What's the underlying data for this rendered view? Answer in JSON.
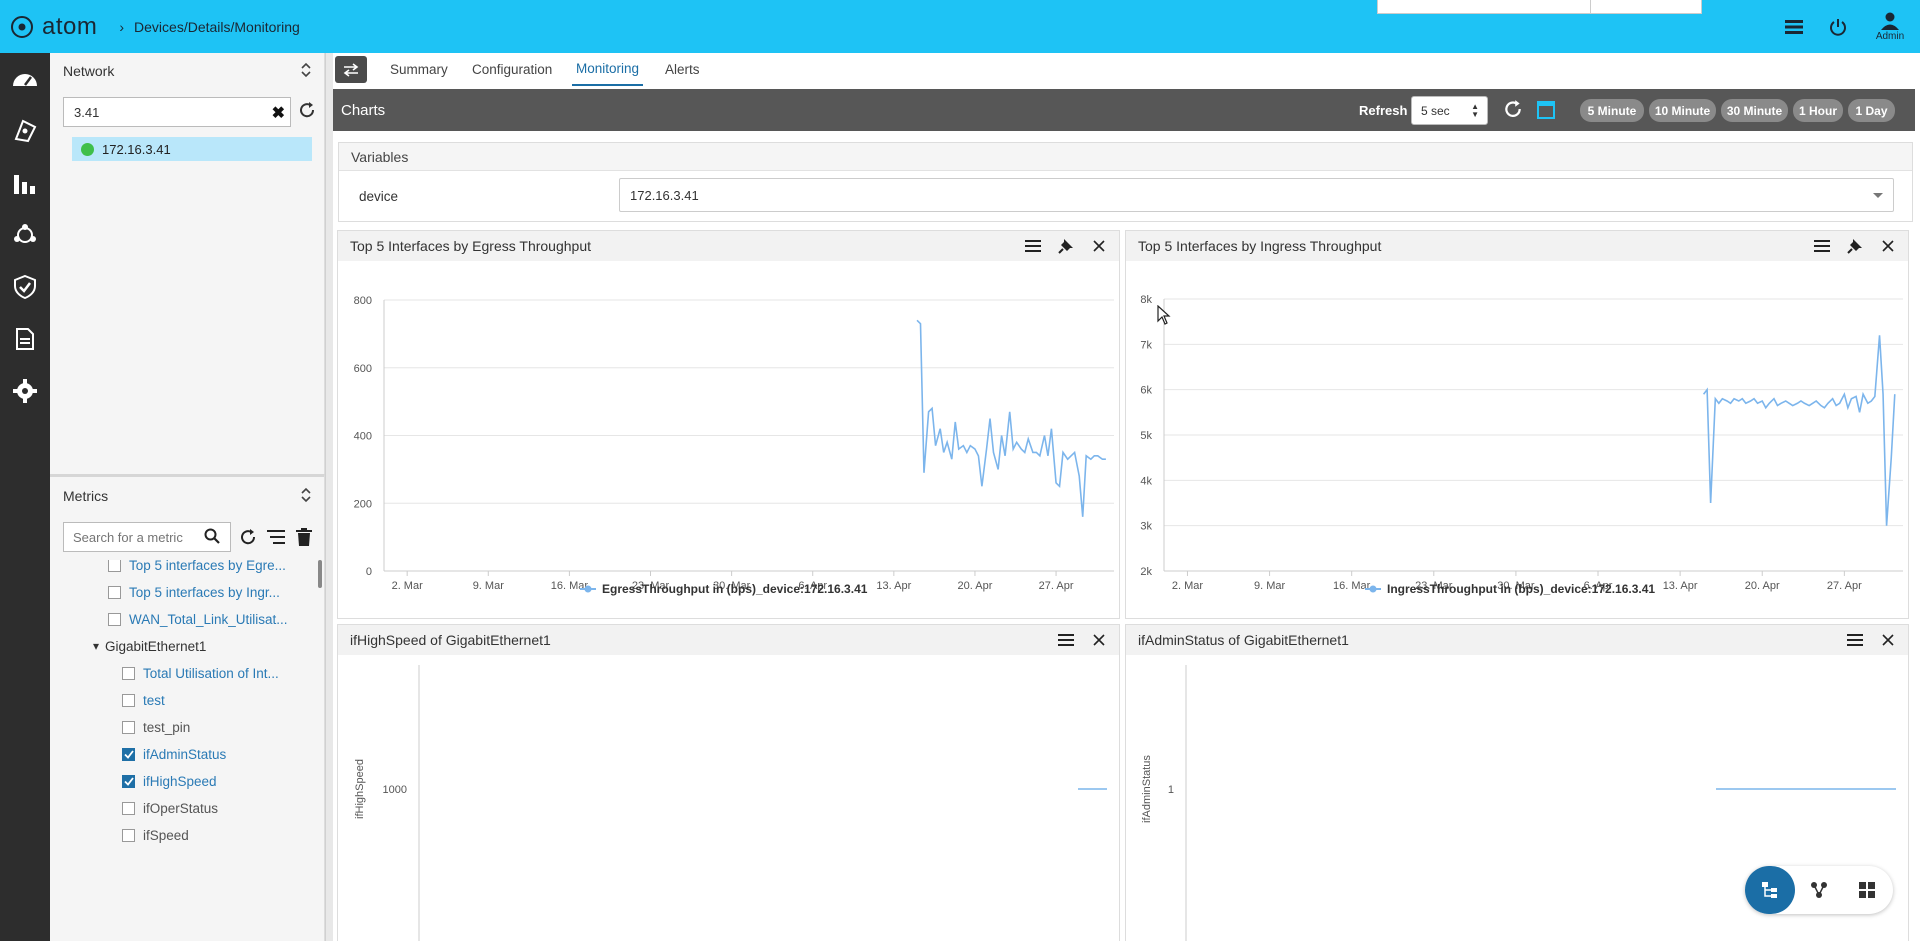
{
  "app": {
    "brand": "atom",
    "breadcrumb": "Devices/Details/Monitoring",
    "user_label": "Admin"
  },
  "network_panel": {
    "title": "Network",
    "search_value": "3.41",
    "node": "172.16.3.41"
  },
  "metrics_panel": {
    "title": "Metrics",
    "search_placeholder": "Search for a metric",
    "items": [
      {
        "label": "Top 5 interfaces by Egre...",
        "checked": false,
        "level": 1
      },
      {
        "label": "Top 5 interfaces by Ingr...",
        "checked": false,
        "level": 1
      },
      {
        "label": "WAN_Total_Link_Utilisat...",
        "checked": false,
        "level": 1
      },
      {
        "label": "GigabitEthernet1",
        "group": true
      },
      {
        "label": "Total Utilisation of Int...",
        "checked": false,
        "level": 2
      },
      {
        "label": "test",
        "checked": false,
        "level": 2
      },
      {
        "label": "test_pin",
        "checked": false,
        "level": 2
      },
      {
        "label": "ifAdminStatus",
        "checked": true,
        "level": 2
      },
      {
        "label": "ifHighSpeed",
        "checked": true,
        "level": 2
      },
      {
        "label": "ifOperStatus",
        "checked": false,
        "level": 2
      },
      {
        "label": "ifSpeed",
        "checked": false,
        "level": 2
      }
    ]
  },
  "tabs": [
    {
      "label": "Summary",
      "active": false
    },
    {
      "label": "Configuration",
      "active": false
    },
    {
      "label": "Monitoring",
      "active": true
    },
    {
      "label": "Alerts",
      "active": false
    }
  ],
  "charts_bar": {
    "title": "Charts",
    "refresh_label": "Refresh",
    "refresh_value": "5 sec",
    "ranges": [
      "5 Minute",
      "10 Minute",
      "30 Minute",
      "1 Hour",
      "1 Day"
    ]
  },
  "variables": {
    "title": "Variables",
    "device_label": "device",
    "device_value": "172.16.3.41"
  },
  "chart_data": [
    {
      "type": "line",
      "title": "Top 5 Interfaces by Egress Throughput",
      "x_ticks": [
        "2. Mar",
        "9. Mar",
        "16. Mar",
        "23. Mar",
        "30. Mar",
        "6. Apr",
        "13. Apr",
        "20. Apr",
        "27. Apr"
      ],
      "y_ticks": [
        "0",
        "200",
        "400",
        "600",
        "800"
      ],
      "ylim": [
        0,
        800
      ],
      "xlim_days": [
        -2,
        61
      ],
      "series": [
        {
          "name": "EgressThroughput in (bps)_device:172.16.3.41",
          "x_days": [
            44,
            44.3,
            44.6,
            45.0,
            45.3,
            45.6,
            46.0,
            46.3,
            46.6,
            47.0,
            47.3,
            47.6,
            48.0,
            48.3,
            48.6,
            49.0,
            49.3,
            49.6,
            50.0,
            50.3,
            50.6,
            51.0,
            51.3,
            51.6,
            52.0,
            52.3,
            52.6,
            53.0,
            53.3,
            53.6,
            54.0,
            54.3,
            54.6,
            55.0,
            55.3,
            55.6,
            56.0,
            56.3,
            56.6,
            57.0,
            57.3,
            57.6,
            58.0,
            58.3,
            58.6,
            59.0,
            59.3,
            59.6,
            60.0,
            60.3
          ],
          "values": [
            740,
            730,
            290,
            470,
            480,
            370,
            420,
            350,
            380,
            330,
            440,
            360,
            370,
            350,
            370,
            360,
            340,
            250,
            360,
            450,
            350,
            300,
            400,
            340,
            470,
            360,
            380,
            360,
            350,
            390,
            350,
            350,
            340,
            400,
            340,
            420,
            260,
            250,
            350,
            330,
            340,
            350,
            280,
            160,
            340,
            330,
            340,
            340,
            330,
            330
          ],
          "color": "#7cb5ec"
        }
      ]
    },
    {
      "type": "line",
      "title": "Top 5 Interfaces by Ingress Throughput",
      "x_ticks": [
        "2. Mar",
        "9. Mar",
        "16. Mar",
        "23. Mar",
        "30. Mar",
        "6. Apr",
        "13. Apr",
        "20. Apr",
        "27. Apr"
      ],
      "y_ticks": [
        "2k",
        "3k",
        "4k",
        "5k",
        "6k",
        "7k",
        "8k"
      ],
      "ylim": [
        2000,
        8000
      ],
      "xlim_days": [
        -2,
        61
      ],
      "series": [
        {
          "name": "IngressThroughput in (bps)_device:172.16.3.41",
          "x_days": [
            44,
            44.3,
            44.6,
            45.0,
            45.3,
            45.6,
            46.0,
            46.3,
            46.6,
            47.0,
            47.3,
            47.6,
            48.0,
            48.3,
            48.6,
            49.0,
            49.3,
            49.6,
            50.0,
            50.3,
            50.6,
            51.0,
            51.3,
            51.6,
            52.0,
            52.3,
            52.6,
            53.0,
            53.3,
            53.6,
            54.0,
            54.3,
            54.6,
            55.0,
            55.3,
            55.6,
            56.0,
            56.3,
            56.6,
            57.0,
            57.3,
            57.6,
            58.0,
            58.3,
            58.6,
            59.0,
            59.3,
            59.6,
            60.0,
            60.3
          ],
          "values": [
            5900,
            6000,
            3500,
            5800,
            5700,
            5800,
            5750,
            5700,
            5800,
            5750,
            5800,
            5700,
            5750,
            5800,
            5700,
            5750,
            5600,
            5700,
            5800,
            5650,
            5700,
            5750,
            5700,
            5650,
            5700,
            5750,
            5700,
            5650,
            5700,
            5750,
            5650,
            5600,
            5700,
            5800,
            5650,
            5700,
            5900,
            5600,
            5800,
            5850,
            5500,
            5900,
            5700,
            5750,
            5850,
            7200,
            5900,
            3000,
            4500,
            5900
          ],
          "color": "#7cb5ec"
        }
      ]
    },
    {
      "type": "line",
      "title": "ifHighSpeed of GigabitEthernet1",
      "ylabel": "ifHighSpeed",
      "y_ticks": [
        "1000"
      ],
      "series": [
        {
          "name": "",
          "values": [
            1000,
            1000
          ],
          "color": "#7cb5ec"
        }
      ]
    },
    {
      "type": "line",
      "title": "ifAdminStatus of GigabitEthernet1",
      "ylabel": "ifAdminStatus",
      "y_ticks": [
        "1"
      ],
      "series": [
        {
          "name": "",
          "values": [
            1,
            1
          ],
          "color": "#7cb5ec"
        }
      ]
    }
  ],
  "colors": {
    "topbar": "#1ec3f5",
    "accent": "#1b6ea6",
    "line": "#7cb5ec"
  },
  "icons": {
    "topbar": [
      "list-icon",
      "power-icon",
      "user-icon"
    ],
    "rail": [
      "dashboard-icon",
      "devices-icon",
      "bar-chart-icon",
      "network-icon",
      "shield-icon",
      "document-icon",
      "settings-icon"
    ]
  }
}
